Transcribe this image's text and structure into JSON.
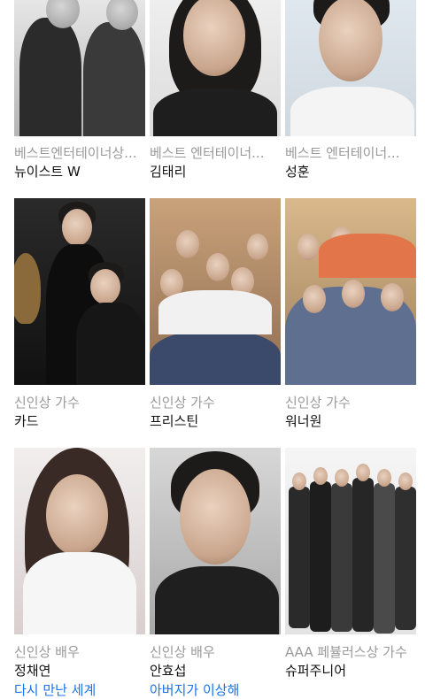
{
  "cards": [
    {
      "category": "베스트엔터테이너상...",
      "name": "뉴이스트 W"
    },
    {
      "category": "베스트 엔터테이너...",
      "name": "김태리"
    },
    {
      "category": "베스트 엔터테이너...",
      "name": "성훈"
    },
    {
      "category": "신인상 가수",
      "name": "카드"
    },
    {
      "category": "신인상 가수",
      "name": "프리스틴"
    },
    {
      "category": "신인상 가수",
      "name": "워너원"
    },
    {
      "category": "신인상 배우",
      "name": "정채연",
      "link": "다시 만난 세계"
    },
    {
      "category": "신인상 배우",
      "name": "안효섭",
      "link": "아버지가 이상해"
    },
    {
      "category": "AAA 페뷸러스상 가수",
      "name": "슈퍼주니어"
    }
  ]
}
